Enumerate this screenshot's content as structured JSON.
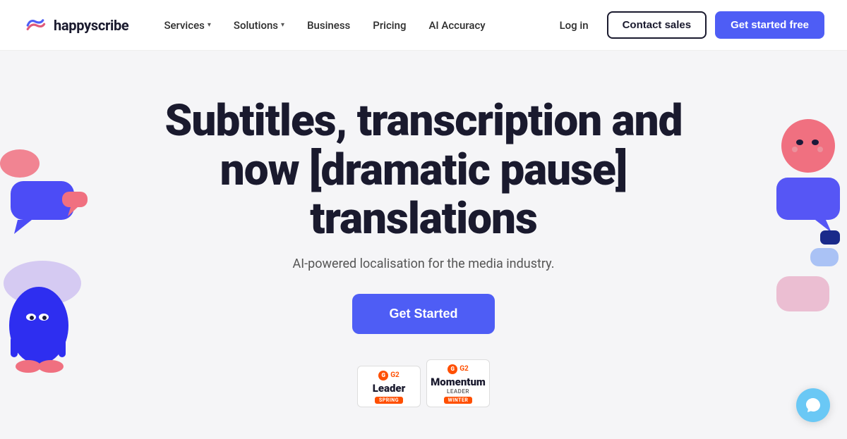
{
  "nav": {
    "logo_text": "happyscribe",
    "links": [
      {
        "label": "Services",
        "has_dropdown": true
      },
      {
        "label": "Solutions",
        "has_dropdown": true
      },
      {
        "label": "Business",
        "has_dropdown": false
      },
      {
        "label": "Pricing",
        "has_dropdown": false
      },
      {
        "label": "AI Accuracy",
        "has_dropdown": false
      }
    ],
    "login_label": "Log in",
    "contact_label": "Contact sales",
    "started_label": "Get started free"
  },
  "hero": {
    "title": "Subtitles, transcription and now [dramatic pause] translations",
    "subtitle": "AI-powered localisation for the media industry.",
    "cta_label": "Get Started"
  },
  "badges": [
    {
      "g2_label": "G2",
      "main": "Leader",
      "sub": "",
      "season": "SPRING"
    },
    {
      "g2_label": "G2",
      "main": "Momentum",
      "sub": "Leader",
      "season": "WINTER"
    }
  ],
  "chat": {
    "icon": "💬"
  },
  "colors": {
    "accent": "#4e5df5",
    "orange": "#ff4f00",
    "light_blue": "#6ac8f5"
  }
}
